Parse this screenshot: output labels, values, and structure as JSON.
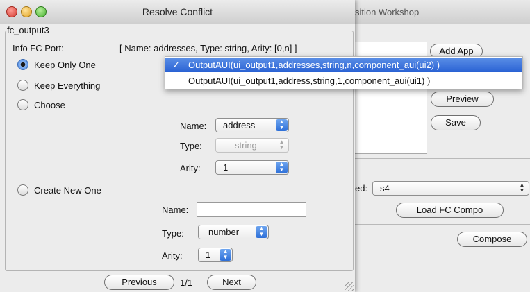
{
  "background_window": {
    "title": "sition Workshop",
    "buttons": {
      "add_app": "Add App",
      "preview": "Preview",
      "save": "Save",
      "load_fc_compo": "Load FC Compo",
      "compose": "Compose"
    },
    "selected_label": "ed:",
    "selected_value": "s4"
  },
  "dialog": {
    "title": "Resolve Conflict",
    "group_title": "fc_output3",
    "info_label": "Info FC Port:",
    "info_value": "[ Name: addresses, Type: string, Arity: [0,n] ]",
    "options": {
      "keep_only_one": "Keep Only One",
      "keep_everything": "Keep Everything",
      "choose": "Choose",
      "create_new_one": "Create New One"
    },
    "selected_option": "keep_only_one",
    "choose_fields": {
      "name_label": "Name:",
      "name_value": "address",
      "type_label": "Type:",
      "type_value": "string",
      "arity_label": "Arity:",
      "arity_value": "1"
    },
    "create_fields": {
      "name_label": "Name:",
      "name_value": "",
      "type_label": "Type:",
      "type_value": "number",
      "arity_label": "Arity:",
      "arity_value": "1"
    },
    "pager": {
      "previous": "Previous",
      "page": "1/1",
      "next": "Next"
    }
  },
  "dropdown": {
    "check": "✓",
    "items": [
      "OutputAUI(ui_output1,addresses,string,n,component_aui(ui2) )",
      "OutputAUI(ui_output1,address,string,1,component_aui(ui1) )"
    ]
  }
}
